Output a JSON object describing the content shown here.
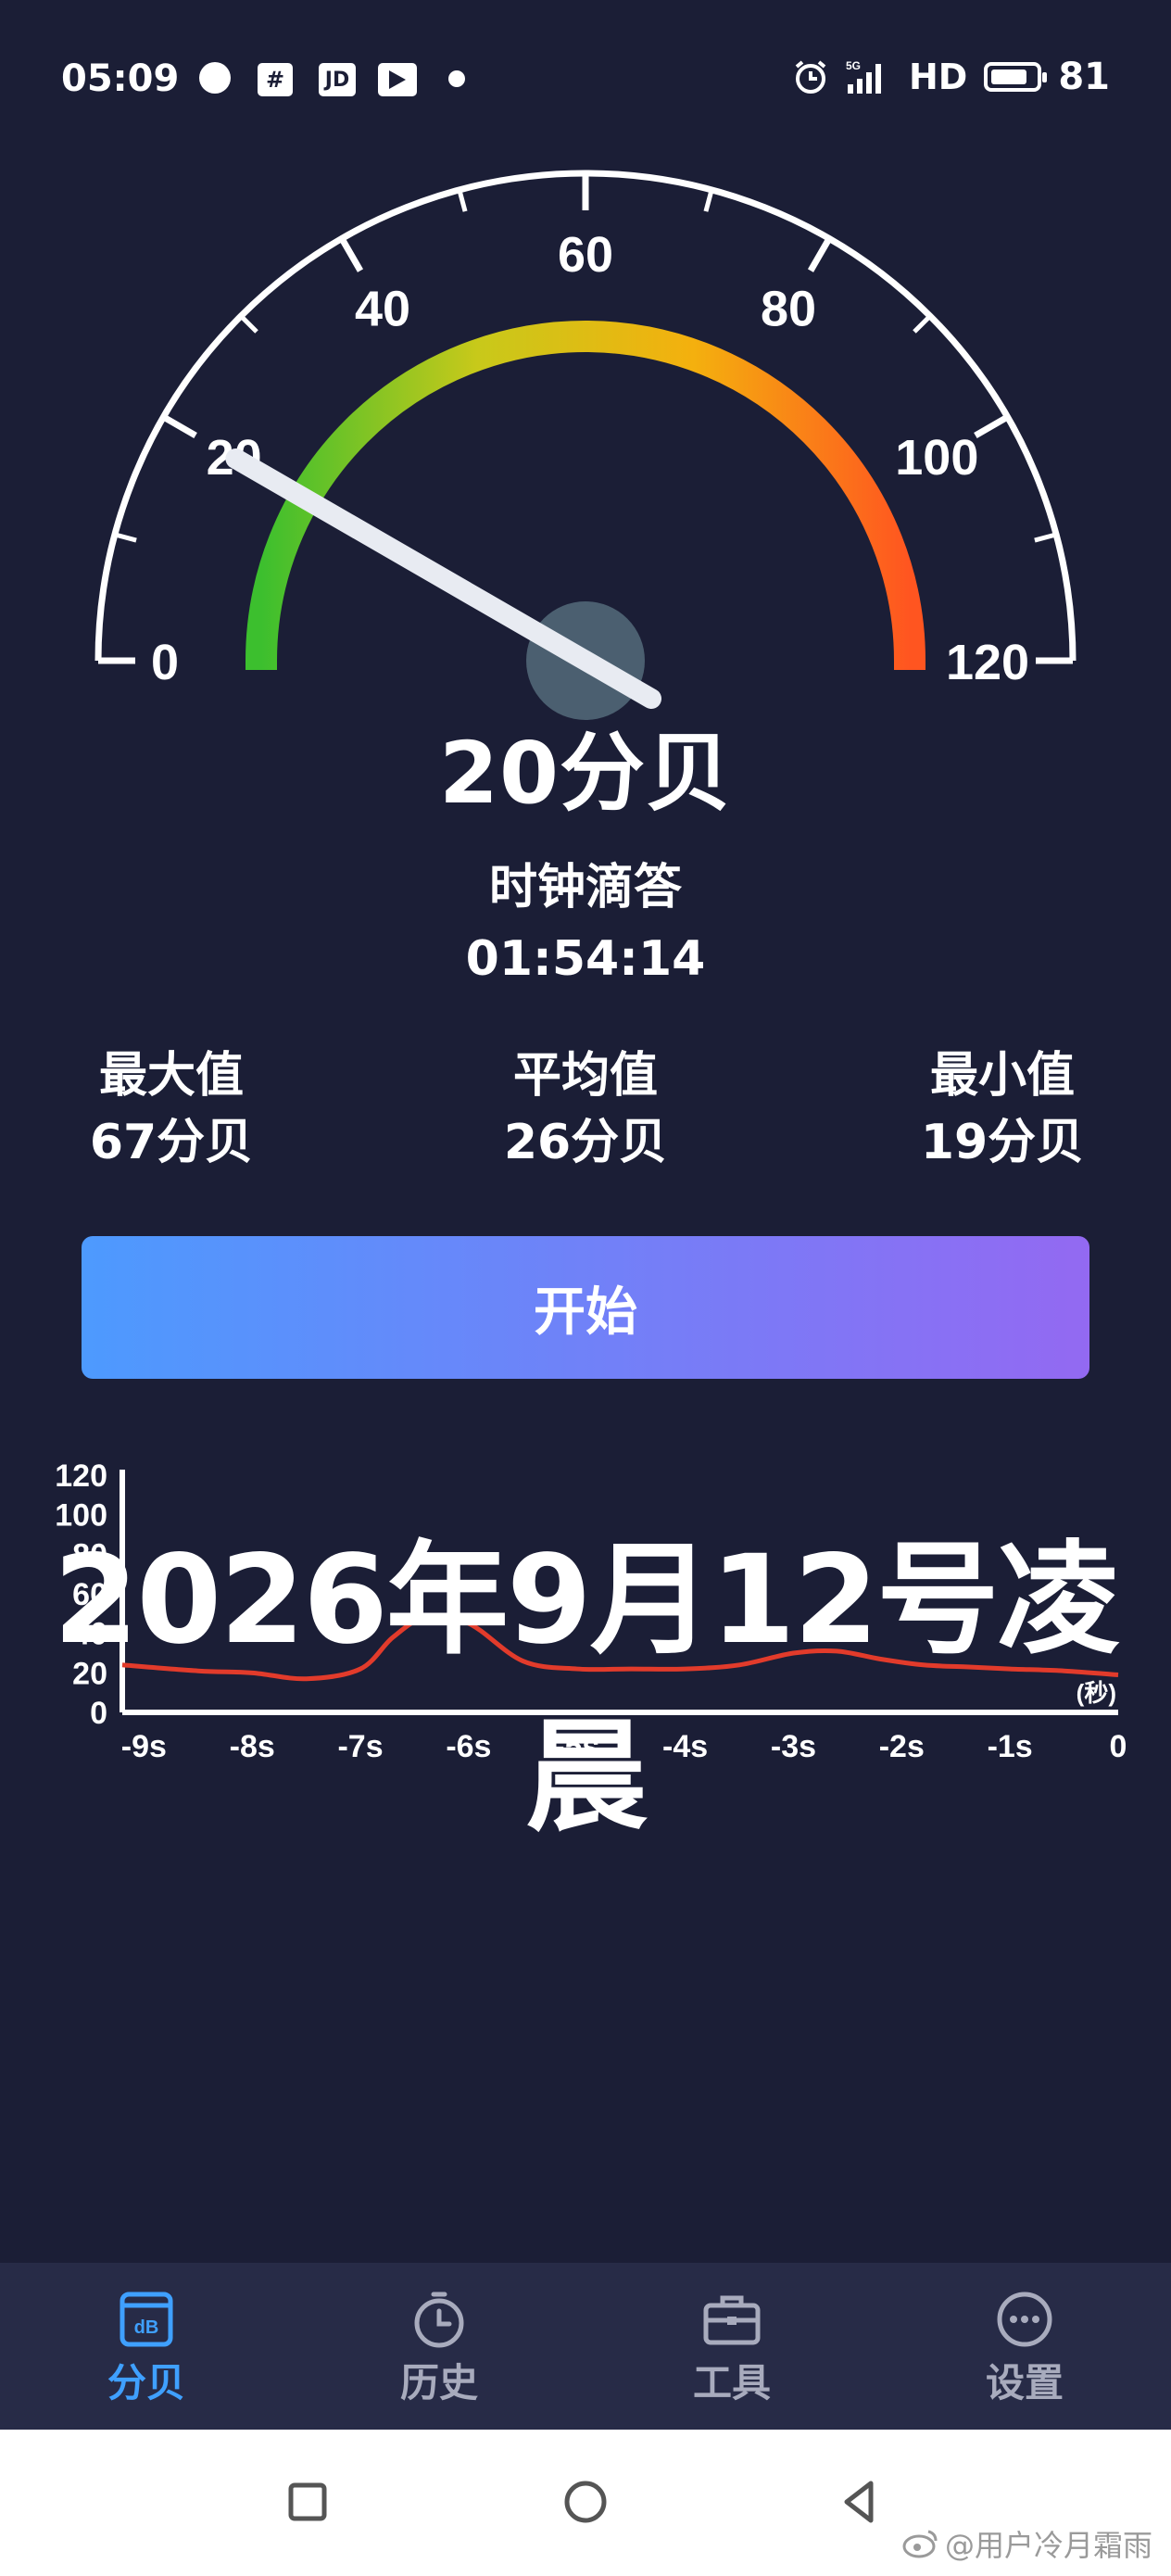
{
  "status_bar": {
    "time": "05:09",
    "icons": [
      "chat-bubble-icon",
      "hash-icon",
      "jd-icon",
      "play-icon",
      "dot-icon"
    ],
    "jd_label": "JD",
    "hash_label": "#",
    "network": "5G",
    "hd_label": "HD",
    "battery": "81",
    "battery_level": 0.81
  },
  "gauge": {
    "min": 0,
    "max": 120,
    "tick_labels": [
      "0",
      "20",
      "40",
      "60",
      "80",
      "100",
      "120"
    ],
    "value": 20,
    "arc_colors": [
      "#3cbf2e",
      "#c8c91a",
      "#f4b00e",
      "#ff5520"
    ]
  },
  "reading": {
    "text": "20分贝"
  },
  "sound_description": "时钟滴答",
  "timer": "01:54:14",
  "stats": {
    "max_label": "最大值",
    "max_value": "67分贝",
    "avg_label": "平均值",
    "avg_value": "26分贝",
    "min_label": "最小值",
    "min_value": "19分贝"
  },
  "start_button": {
    "label": "开始"
  },
  "overlay_text": "2026年9月12号凌晨",
  "chart_data": {
    "type": "line",
    "y_ticks": [
      "120",
      "100",
      "80",
      "60",
      "40",
      "20",
      "0"
    ],
    "x_ticks": [
      "-9s",
      "-8s",
      "-7s",
      "-6s",
      "-5s",
      "-4s",
      "-3s",
      "-2s",
      "-1s",
      "0"
    ],
    "unit_label": "(秒)",
    "ylim": [
      0,
      120
    ],
    "xlim": [
      -9.2,
      0
    ],
    "line_color": "#e23b2b",
    "x": [
      -9.2,
      -8.5,
      -8.0,
      -7.5,
      -7.0,
      -6.7,
      -6.4,
      -6.0,
      -5.5,
      -5.0,
      -4.5,
      -4.0,
      -3.5,
      -3.0,
      -2.6,
      -2.2,
      -1.8,
      -1.4,
      -1.0,
      -0.5,
      0
    ],
    "values": [
      24,
      21,
      20,
      17,
      22,
      38,
      48,
      45,
      26,
      22,
      22,
      22,
      24,
      30,
      31,
      27,
      24,
      23,
      22,
      21,
      19
    ]
  },
  "bottom_nav": {
    "items": [
      {
        "label": "分贝",
        "icon": "decibel-icon",
        "active": true
      },
      {
        "label": "历史",
        "icon": "clock-icon",
        "active": false
      },
      {
        "label": "工具",
        "icon": "toolbox-icon",
        "active": false
      },
      {
        "label": "设置",
        "icon": "more-icon",
        "active": false
      }
    ],
    "db_badge": "dB"
  },
  "system_nav": {
    "icons": [
      "recents-square-icon",
      "home-circle-icon",
      "back-triangle-icon"
    ]
  },
  "watermark": "@用户冷月霜雨"
}
